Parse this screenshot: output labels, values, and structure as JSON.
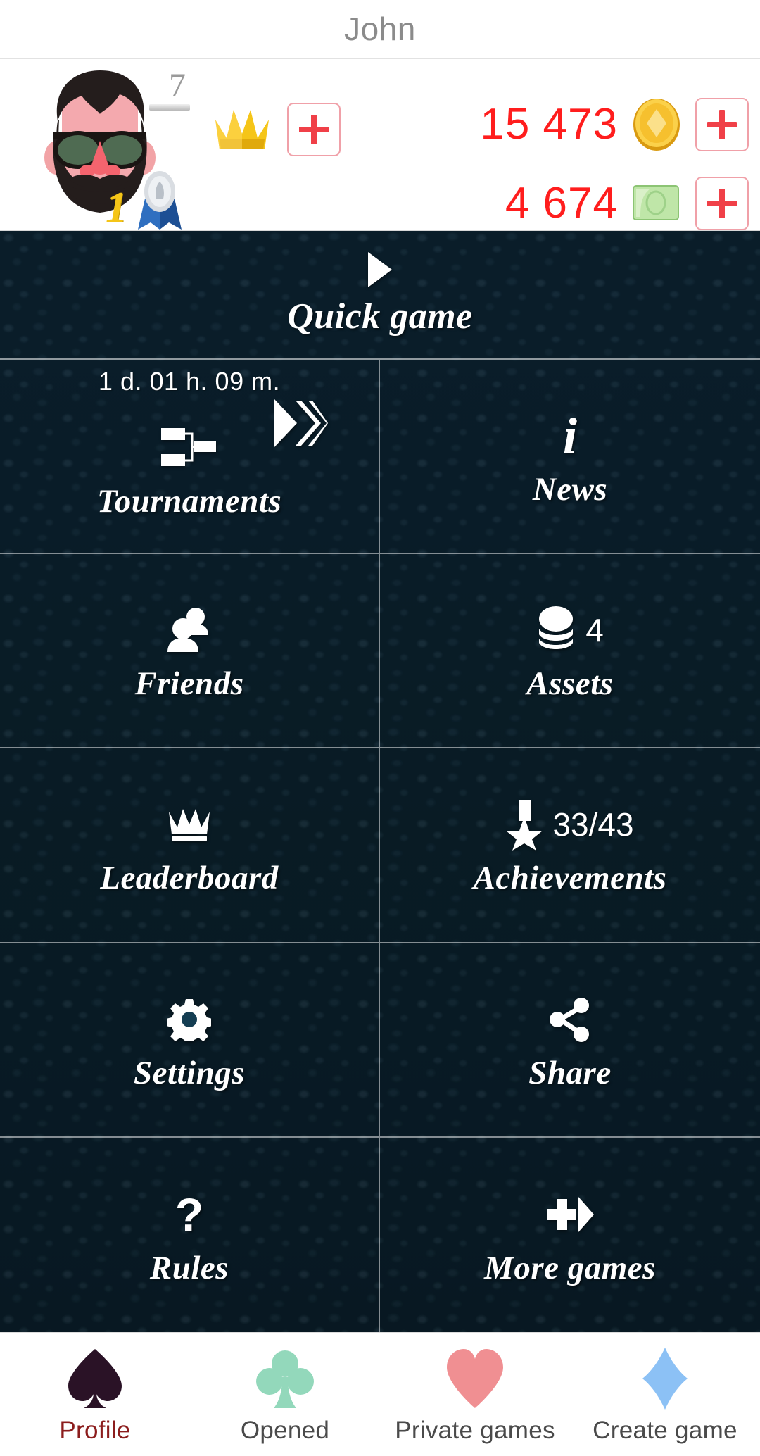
{
  "window": {
    "title": "John"
  },
  "header": {
    "avatar": {
      "name": "player-avatar",
      "level": "7",
      "rank": "1",
      "medal": "silver-ribbon-medal"
    },
    "crown": {
      "icon": "crown-icon",
      "add_label": "+"
    },
    "currencies": [
      {
        "value": "15 473",
        "icon": "gold-coin-icon",
        "add_label": "+"
      },
      {
        "value": "4 674",
        "icon": "banknote-icon",
        "add_label": "+"
      }
    ]
  },
  "menu": {
    "quick_game": {
      "label": "Quick game",
      "icon": "play-triangle-icon"
    },
    "items": [
      {
        "label": "Tournaments",
        "icon": "tournament-bracket-icon",
        "timer": "1 d. 01 h. 09 m.",
        "chevron": "triple-chevron-right-icon"
      },
      {
        "label": "News",
        "icon": "info-i-icon"
      },
      {
        "label": "Friends",
        "icon": "people-icon"
      },
      {
        "label": "Assets",
        "icon": "coin-stack-icon",
        "count": "4"
      },
      {
        "label": "Leaderboard",
        "icon": "crown-icon"
      },
      {
        "label": "Achievements",
        "icon": "medal-star-icon",
        "count": "33/43"
      },
      {
        "label": "Settings",
        "icon": "gear-icon"
      },
      {
        "label": "Share",
        "icon": "share-nodes-icon"
      },
      {
        "label": "Rules",
        "icon": "question-mark-icon"
      },
      {
        "label": "More games",
        "icon": "arrow-cross-right-icon"
      }
    ]
  },
  "tabbar": {
    "tabs": [
      {
        "label": "Profile",
        "icon": "spade-suit-icon",
        "color": "#2a1226",
        "active": true
      },
      {
        "label": "Opened",
        "icon": "club-suit-icon",
        "color": "#93d8bb",
        "active": false
      },
      {
        "label": "Private games",
        "icon": "heart-suit-icon",
        "color": "#f08f92",
        "active": false
      },
      {
        "label": "Create game",
        "icon": "diamond-suit-icon",
        "color": "#8cc1f5",
        "active": false
      }
    ]
  },
  "colors": {
    "accent_red": "#ff1d1d",
    "leather_bg": "#123c50",
    "title_gray": "#8b8b8b",
    "active_tab": "#8c1d1d"
  }
}
